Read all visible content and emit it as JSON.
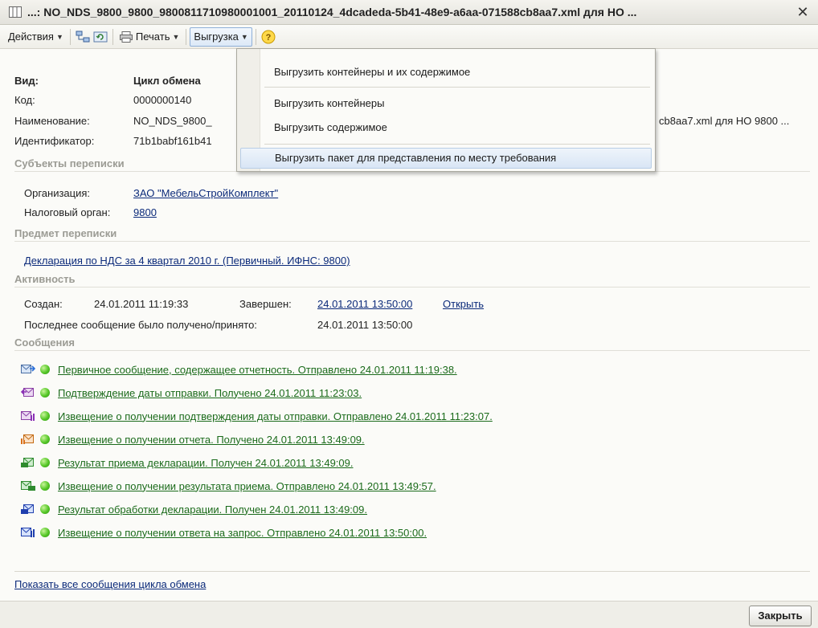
{
  "window": {
    "title": "...: NO_NDS_9800_9800_9800811710980001001_20110124_4dcadeda-5b41-48e9-a6aa-071588cb8aa7.xml для НО ...",
    "close_label": "✕"
  },
  "toolbar": {
    "actions_label": "Действия",
    "print_label": "Печать",
    "export_label": "Выгрузка",
    "help_label": "?"
  },
  "dropdown": {
    "items": [
      "Выгрузить контейнеры и их содержимое",
      "Выгрузить контейнеры",
      "Выгрузить содержимое",
      "Выгрузить пакет для представления по месту требования"
    ]
  },
  "fields": {
    "kind_label": "Вид:",
    "kind_value": "Цикл обмена",
    "code_label": "Код:",
    "code_value": "0000000140",
    "name_label": "Наименование:",
    "name_value_start": "NO_NDS_9800_",
    "name_value_end": "cb8aa7.xml для НО 9800 ...",
    "id_label": "Идентификатор:",
    "id_value": "71b1babf161b41"
  },
  "sections": {
    "subjects": "Субъекты переписки",
    "subject_matter": "Предмет переписки",
    "activity": "Активность",
    "messages": "Сообщения"
  },
  "subjects": {
    "org_label": "Организация:",
    "org_value": "ЗАО \"МебельСтройКомплект\"",
    "tax_label": "Налоговый орган:",
    "tax_value": "9800"
  },
  "subject_matter": {
    "declaration_link": "Декларация по НДС за 4 квартал 2010 г. (Первичный. ИФНС: 9800)"
  },
  "activity": {
    "created_label": "Создан:",
    "created_value": "24.01.2011 11:19:33",
    "completed_label": "Завершен:",
    "completed_value": "24.01.2011 13:50:00",
    "open_link": "Открыть",
    "last_msg_label": "Последнее сообщение было получено/принято:",
    "last_msg_value": "24.01.2011 13:50:00"
  },
  "messages": [
    {
      "text": "Первичное сообщение, содержащее отчетность. Отправлено 24.01.2011 11:19:38.",
      "icon": "envelope-send-icon"
    },
    {
      "text": "Подтверждение даты отправки. Получено 24.01.2011 11:23:03.",
      "icon": "envelope-confirm-icon"
    },
    {
      "text": "Извещение о получении подтверждения даты отправки. Отправлено 24.01.2011 11:23:07.",
      "icon": "envelope-notice-icon"
    },
    {
      "text": "Извещение о получении отчета. Получено 24.01.2011 13:49:09.",
      "icon": "envelope-receipt-icon"
    },
    {
      "text": "Результат приема декларации. Получен 24.01.2011 13:49:09.",
      "icon": "envelope-result-icon"
    },
    {
      "text": "Извещение о получении результата приема. Отправлено 24.01.2011 13:49:57.",
      "icon": "envelope-result-notice-icon"
    },
    {
      "text": "Результат обработки декларации. Получен 24.01.2011 13:49:09.",
      "icon": "envelope-processing-icon"
    },
    {
      "text": "Извещение о получении ответа на запрос. Отправлено 24.01.2011 13:50:00.",
      "icon": "envelope-answer-icon"
    }
  ],
  "footer": {
    "show_all_link": "Показать все сообщения цикла обмена",
    "close_button": "Закрыть"
  },
  "colors": {
    "link_blue": "#0b2a7a",
    "link_green": "#1b6b1b",
    "section_gray": "#9b9b94",
    "status_green": "#54c626"
  }
}
